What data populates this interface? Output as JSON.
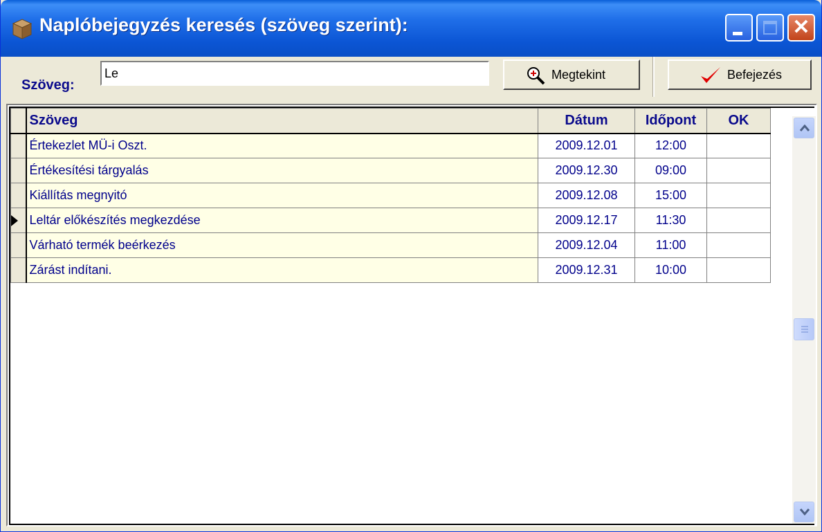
{
  "window": {
    "title": "Naplóbejegyzés keresés (szöveg szerint):",
    "controls": {
      "minimize": "minimize-icon",
      "maximize": "maximize-icon",
      "close": "close-icon"
    },
    "close_glyph": "✕"
  },
  "toolbar": {
    "search_label": "Szöveg:",
    "search_value": "Le",
    "view_button": "Megtekint",
    "finish_button": "Befejezés"
  },
  "grid": {
    "columns": [
      "Szöveg",
      "Dátum",
      "Időpont",
      "OK"
    ],
    "rows": [
      {
        "text": "Értekezlet MÜ-i Oszt.",
        "date": "2009.12.01",
        "time": "12:00",
        "ok": ""
      },
      {
        "text": "Értékesítési tárgyalás",
        "date": "2009.12.30",
        "time": "09:00",
        "ok": ""
      },
      {
        "text": "Kiállítás megnyitó",
        "date": "2009.12.08",
        "time": "15:00",
        "ok": ""
      },
      {
        "text": "Leltár előkészítés megkezdése",
        "date": "2009.12.17",
        "time": "11:30",
        "ok": "",
        "current": true
      },
      {
        "text": "Várható termék beérkezés",
        "date": "2009.12.04",
        "time": "11:00",
        "ok": ""
      },
      {
        "text": "Zárást indítani.",
        "date": "2009.12.31",
        "time": "10:00",
        "ok": ""
      }
    ]
  },
  "colors": {
    "titlebar": "#0b55d4",
    "row_bg": "#ffffe6",
    "text_blue": "#00008b",
    "check_red": "#e00000"
  }
}
